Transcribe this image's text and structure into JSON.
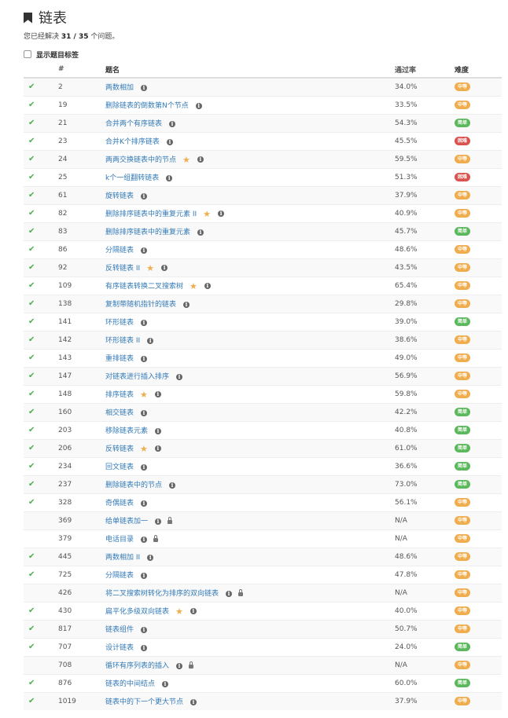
{
  "header": {
    "title": "链表",
    "solved_prefix": "您已经解决 ",
    "solved_count": "31 / 35",
    "solved_suffix": " 个问题。",
    "show_tags_label": "显示题目标签"
  },
  "table": {
    "columns": [
      "#",
      "题名",
      "通过率",
      "难度"
    ],
    "rows": [
      {
        "solved": true,
        "id": "2",
        "name": "两数相加",
        "star": false,
        "lock": false,
        "rate": "34.0%",
        "difficulty": "中等",
        "level": "mid"
      },
      {
        "solved": true,
        "id": "19",
        "name": "删除链表的倒数第N个节点",
        "star": false,
        "lock": false,
        "rate": "33.5%",
        "difficulty": "中等",
        "level": "mid"
      },
      {
        "solved": true,
        "id": "21",
        "name": "合并两个有序链表",
        "star": false,
        "lock": false,
        "rate": "54.3%",
        "difficulty": "简单",
        "level": "easy"
      },
      {
        "solved": true,
        "id": "23",
        "name": "合并K个排序链表",
        "star": false,
        "lock": false,
        "rate": "45.5%",
        "difficulty": "困难",
        "level": "hard"
      },
      {
        "solved": true,
        "id": "24",
        "name": "两两交换链表中的节点",
        "star": true,
        "lock": false,
        "rate": "59.5%",
        "difficulty": "中等",
        "level": "mid"
      },
      {
        "solved": true,
        "id": "25",
        "name": "k个一组翻转链表",
        "star": false,
        "lock": false,
        "rate": "51.3%",
        "difficulty": "困难",
        "level": "hard"
      },
      {
        "solved": true,
        "id": "61",
        "name": "旋转链表",
        "star": false,
        "lock": false,
        "rate": "37.9%",
        "difficulty": "中等",
        "level": "mid"
      },
      {
        "solved": true,
        "id": "82",
        "name": "删除排序链表中的重复元素 II",
        "star": true,
        "lock": false,
        "rate": "40.9%",
        "difficulty": "中等",
        "level": "mid"
      },
      {
        "solved": true,
        "id": "83",
        "name": "删除排序链表中的重复元素",
        "star": false,
        "lock": false,
        "rate": "45.7%",
        "difficulty": "简单",
        "level": "easy"
      },
      {
        "solved": true,
        "id": "86",
        "name": "分隔链表",
        "star": false,
        "lock": false,
        "rate": "48.6%",
        "difficulty": "中等",
        "level": "mid"
      },
      {
        "solved": true,
        "id": "92",
        "name": "反转链表 II",
        "star": true,
        "lock": false,
        "rate": "43.5%",
        "difficulty": "中等",
        "level": "mid"
      },
      {
        "solved": true,
        "id": "109",
        "name": "有序链表转换二叉搜索树",
        "star": true,
        "lock": false,
        "rate": "65.4%",
        "difficulty": "中等",
        "level": "mid"
      },
      {
        "solved": true,
        "id": "138",
        "name": "复制带随机指针的链表",
        "star": false,
        "lock": false,
        "rate": "29.8%",
        "difficulty": "中等",
        "level": "mid"
      },
      {
        "solved": true,
        "id": "141",
        "name": "环形链表",
        "star": false,
        "lock": false,
        "rate": "39.0%",
        "difficulty": "简单",
        "level": "easy"
      },
      {
        "solved": true,
        "id": "142",
        "name": "环形链表 II",
        "star": false,
        "lock": false,
        "rate": "38.6%",
        "difficulty": "中等",
        "level": "mid"
      },
      {
        "solved": true,
        "id": "143",
        "name": "重排链表",
        "star": false,
        "lock": false,
        "rate": "49.0%",
        "difficulty": "中等",
        "level": "mid"
      },
      {
        "solved": true,
        "id": "147",
        "name": "对链表进行插入排序",
        "star": false,
        "lock": false,
        "rate": "56.9%",
        "difficulty": "中等",
        "level": "mid"
      },
      {
        "solved": true,
        "id": "148",
        "name": "排序链表",
        "star": true,
        "lock": false,
        "rate": "59.8%",
        "difficulty": "中等",
        "level": "mid"
      },
      {
        "solved": true,
        "id": "160",
        "name": "相交链表",
        "star": false,
        "lock": false,
        "rate": "42.2%",
        "difficulty": "简单",
        "level": "easy"
      },
      {
        "solved": true,
        "id": "203",
        "name": "移除链表元素",
        "star": false,
        "lock": false,
        "rate": "40.8%",
        "difficulty": "简单",
        "level": "easy"
      },
      {
        "solved": true,
        "id": "206",
        "name": "反转链表",
        "star": true,
        "lock": false,
        "rate": "61.0%",
        "difficulty": "简单",
        "level": "easy"
      },
      {
        "solved": true,
        "id": "234",
        "name": "回文链表",
        "star": false,
        "lock": false,
        "rate": "36.6%",
        "difficulty": "简单",
        "level": "easy"
      },
      {
        "solved": true,
        "id": "237",
        "name": "删除链表中的节点",
        "star": false,
        "lock": false,
        "rate": "73.0%",
        "difficulty": "简单",
        "level": "easy"
      },
      {
        "solved": true,
        "id": "328",
        "name": "奇偶链表",
        "star": false,
        "lock": false,
        "rate": "56.1%",
        "difficulty": "中等",
        "level": "mid"
      },
      {
        "solved": false,
        "id": "369",
        "name": "给单链表加一",
        "star": false,
        "lock": true,
        "rate": "N/A",
        "difficulty": "中等",
        "level": "mid"
      },
      {
        "solved": false,
        "id": "379",
        "name": "电话目录",
        "star": false,
        "lock": true,
        "rate": "N/A",
        "difficulty": "中等",
        "level": "mid"
      },
      {
        "solved": true,
        "id": "445",
        "name": "两数相加 II",
        "star": false,
        "lock": false,
        "rate": "48.6%",
        "difficulty": "中等",
        "level": "mid"
      },
      {
        "solved": true,
        "id": "725",
        "name": "分隔链表",
        "star": false,
        "lock": false,
        "rate": "47.8%",
        "difficulty": "中等",
        "level": "mid"
      },
      {
        "solved": false,
        "id": "426",
        "name": "将二叉搜索树转化为排序的双向链表",
        "star": false,
        "lock": true,
        "rate": "N/A",
        "difficulty": "中等",
        "level": "mid"
      },
      {
        "solved": true,
        "id": "430",
        "name": "扁平化多级双向链表",
        "star": true,
        "lock": false,
        "rate": "40.0%",
        "difficulty": "中等",
        "level": "mid"
      },
      {
        "solved": true,
        "id": "817",
        "name": "链表组件",
        "star": false,
        "lock": false,
        "rate": "50.7%",
        "difficulty": "中等",
        "level": "mid"
      },
      {
        "solved": true,
        "id": "707",
        "name": "设计链表",
        "star": false,
        "lock": false,
        "rate": "24.0%",
        "difficulty": "简单",
        "level": "easy"
      },
      {
        "solved": false,
        "id": "708",
        "name": "循环有序列表的插入",
        "star": false,
        "lock": true,
        "rate": "N/A",
        "difficulty": "中等",
        "level": "mid"
      },
      {
        "solved": true,
        "id": "876",
        "name": "链表的中间结点",
        "star": false,
        "lock": false,
        "rate": "60.0%",
        "difficulty": "简单",
        "level": "easy"
      },
      {
        "solved": true,
        "id": "1019",
        "name": "链表中的下一个更大节点",
        "star": false,
        "lock": false,
        "rate": "37.9%",
        "difficulty": "中等",
        "level": "mid"
      }
    ]
  },
  "icons": {
    "check": "check-icon",
    "info": "info-icon",
    "star": "star-icon",
    "lock": "lock-icon",
    "bookmark": "bookmark-icon"
  },
  "colors": {
    "link": "#337ab7",
    "check": "#4cae4c",
    "easy": "#5cb85c",
    "mid": "#f0ad4e",
    "hard": "#d9534f",
    "star": "#f0ad4e"
  }
}
